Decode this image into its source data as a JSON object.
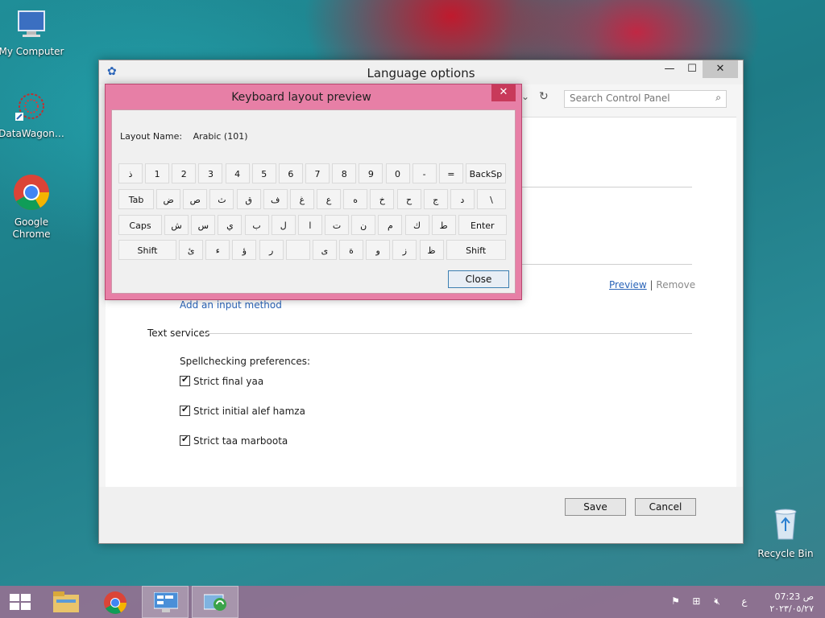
{
  "desktop": {
    "icons": [
      {
        "label": "My Computer"
      },
      {
        "label": "DataWagon…"
      },
      {
        "label": "Google Chrome"
      },
      {
        "label": "Recycle Bin"
      }
    ]
  },
  "main_window": {
    "title": "Language options",
    "controls": {
      "minimize": "—",
      "maximize": "☐",
      "close": "✕"
    },
    "search_placeholder": "Search Control Panel",
    "input_method": {
      "preview_link": "Preview",
      "separator": "|",
      "remove_link": "Remove",
      "add_link": "Add an input method"
    },
    "text_services": {
      "heading": "Text services",
      "spellcheck_label": "Spellchecking preferences:",
      "options": [
        {
          "label": "Strict final yaa",
          "checked": true
        },
        {
          "label": "Strict initial alef hamza",
          "checked": true
        },
        {
          "label": "Strict taa marboota",
          "checked": true
        }
      ]
    },
    "footer": {
      "save": "Save",
      "cancel": "Cancel"
    }
  },
  "keyboard_dialog": {
    "title": "Keyboard layout preview",
    "close_x": "✕",
    "layout_name_label": "Layout Name:",
    "layout_name_value": "Arabic (101)",
    "rows": [
      [
        "ذ",
        "1",
        "2",
        "3",
        "4",
        "5",
        "6",
        "7",
        "8",
        "9",
        "0",
        "-",
        "=",
        "BackSp"
      ],
      [
        "Tab",
        "ض",
        "ص",
        "ث",
        "ق",
        "ف",
        "غ",
        "ع",
        "ه",
        "خ",
        "ح",
        "ج",
        "د",
        "\\"
      ],
      [
        "Caps",
        "ش",
        "س",
        "ي",
        "ب",
        "ل",
        "ا",
        "ت",
        "ن",
        "م",
        "ك",
        "ط",
        "Enter"
      ],
      [
        "Shift",
        "ئ",
        "ء",
        "ؤ",
        "ر",
        "",
        "ى",
        "ة",
        "و",
        "ز",
        "ظ",
        "Shift"
      ]
    ],
    "close_button": "Close"
  },
  "taskbar": {
    "clock_time": "ص 07:23",
    "clock_date": "٢٠٢٣/٠٥/٢٧",
    "lang_indicator": "ع"
  }
}
